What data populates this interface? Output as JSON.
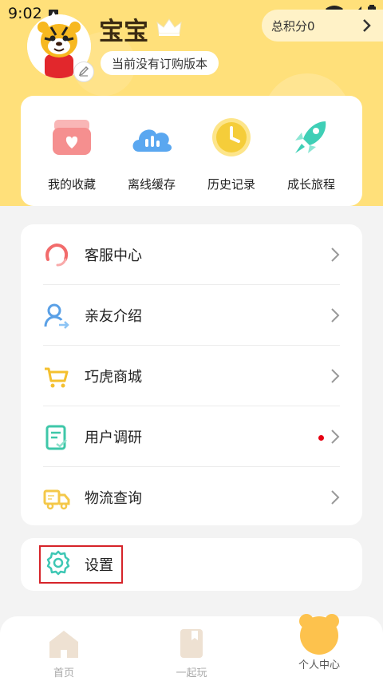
{
  "status_bar": {
    "time": "9:02"
  },
  "profile": {
    "username": "宝宝",
    "version_text": "当前没有订购版本",
    "points_label": "总积分0"
  },
  "quick_actions": [
    {
      "label": "我的收藏",
      "icon": "favorites-box-icon",
      "color": "#f58f8f"
    },
    {
      "label": "离线缓存",
      "icon": "cloud-bars-icon",
      "color": "#5aa7f0"
    },
    {
      "label": "历史记录",
      "icon": "clock-icon",
      "color": "#f5cd3a"
    },
    {
      "label": "成长旅程",
      "icon": "rocket-icon",
      "color": "#3fcfb6"
    }
  ],
  "menu": [
    {
      "label": "客服中心",
      "icon": "headset-icon",
      "color": "#f26b6b",
      "has_dot": false
    },
    {
      "label": "亲友介绍",
      "icon": "user-share-icon",
      "color": "#5aa0e6",
      "has_dot": false
    },
    {
      "label": "巧虎商城",
      "icon": "cart-icon",
      "color": "#f4c02f",
      "has_dot": false
    },
    {
      "label": "用户调研",
      "icon": "survey-icon",
      "color": "#3ec7a8",
      "has_dot": true
    },
    {
      "label": "物流查询",
      "icon": "truck-icon",
      "color": "#f4c84a",
      "has_dot": false
    }
  ],
  "settings": {
    "label": "设置",
    "icon": "gear-icon",
    "color": "#3ec7b4"
  },
  "tabs": [
    {
      "label": "首页",
      "icon": "home-icon",
      "active": false
    },
    {
      "label": "一起玩",
      "icon": "play-icon",
      "active": false
    },
    {
      "label": "个人中心",
      "icon": "bear-face-icon",
      "active": true
    }
  ],
  "colors": {
    "header_bg": "#ffe07a",
    "highlight": "#d6242a"
  }
}
